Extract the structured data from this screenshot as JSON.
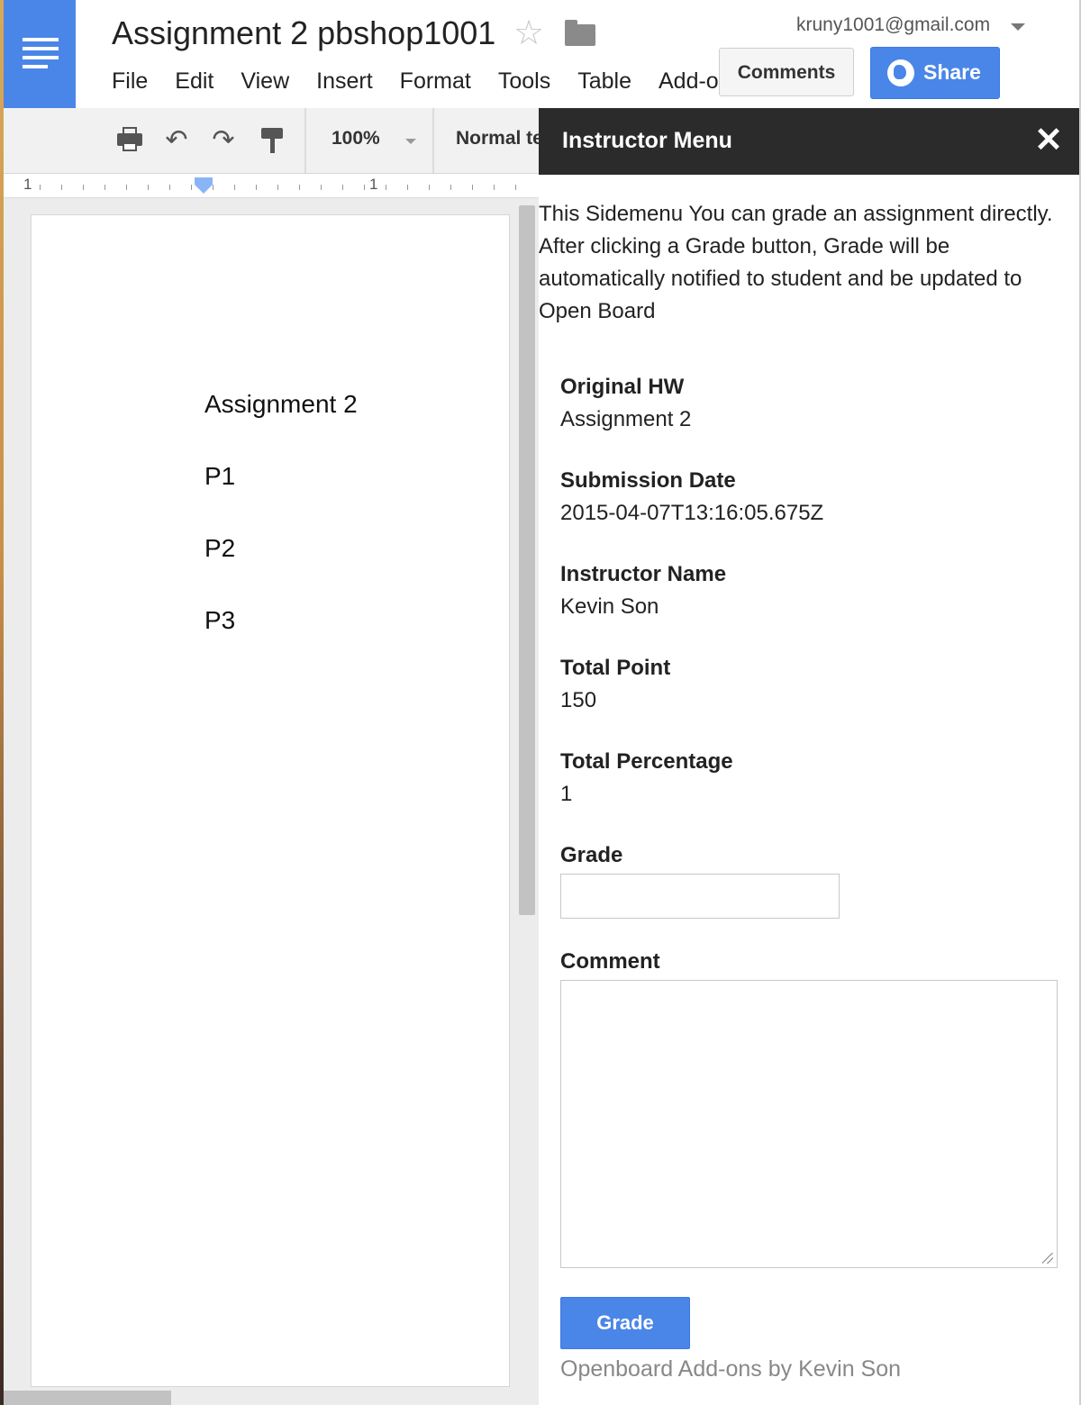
{
  "app": {
    "title": "Assignment 2 pbshop1001",
    "account": "kruny1001@gmail.com",
    "menu": [
      "File",
      "Edit",
      "View",
      "Insert",
      "Format",
      "Tools",
      "Table",
      "Add-ons"
    ],
    "comments_label": "Comments",
    "share_label": "Share"
  },
  "toolbar": {
    "zoom": "100%",
    "style": "Normal text",
    "icons": [
      "print-icon",
      "undo-icon",
      "redo-icon",
      "paint-format-icon"
    ]
  },
  "ruler": {
    "left_number": "1",
    "mid_number": "1"
  },
  "document": {
    "lines": [
      "Assignment 2",
      "P1",
      "P2",
      "P3"
    ]
  },
  "sidebar": {
    "title": "Instructor Menu",
    "description": "This Sidemenu You can grade an assignment directly. After clicking a Grade button, Grade will be automatically notified to student and be updated to Open Board",
    "fields": [
      {
        "label": "Original HW",
        "value": "Assignment 2"
      },
      {
        "label": "Submission Date",
        "value": "2015-04-07T13:16:05.675Z"
      },
      {
        "label": "Instructor Name",
        "value": "Kevin Son"
      },
      {
        "label": "Total Point",
        "value": "150"
      },
      {
        "label": "Total Percentage",
        "value": "1"
      }
    ],
    "grade_label": "Grade",
    "grade_value": "",
    "comment_label": "Comment",
    "comment_value": "",
    "grade_button": "Grade",
    "credit": "Openboard Add-ons by Kevin Son"
  },
  "colors": {
    "accent": "#4a86e8",
    "sidebar_header": "#2b2b2b",
    "toolbar_bg": "#f1f1f1"
  }
}
